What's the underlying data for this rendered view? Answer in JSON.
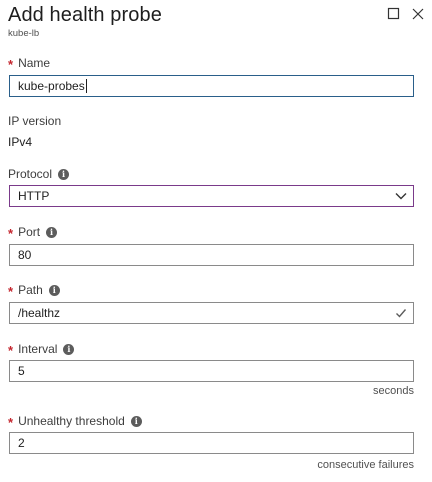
{
  "header": {
    "title": "Add health probe",
    "subtitle": "kube-lb"
  },
  "icons": {
    "maximize": "maximize-icon",
    "close": "close-icon",
    "info": "info-icon",
    "check": "check-icon",
    "chevron": "chevron-down-icon"
  },
  "colors": {
    "required": "#c4262e",
    "focus_border": "#2a5f8a",
    "select_border": "#7a3a8a",
    "valid_check": "#5c5c5c"
  },
  "form": {
    "name": {
      "label": "Name",
      "required": "*",
      "value": "kube-probes"
    },
    "ip_version": {
      "label": "IP version",
      "value": "IPv4"
    },
    "protocol": {
      "label": "Protocol",
      "info": "i",
      "value": "HTTP"
    },
    "port": {
      "label": "Port",
      "required": "*",
      "info": "i",
      "value": "80"
    },
    "path": {
      "label": "Path",
      "required": "*",
      "info": "i",
      "value": "/healthz"
    },
    "interval": {
      "label": "Interval",
      "required": "*",
      "info": "i",
      "value": "5",
      "hint": "seconds"
    },
    "unhealthy_threshold": {
      "label": "Unhealthy threshold",
      "required": "*",
      "info": "i",
      "value": "2",
      "hint": "consecutive failures"
    }
  }
}
